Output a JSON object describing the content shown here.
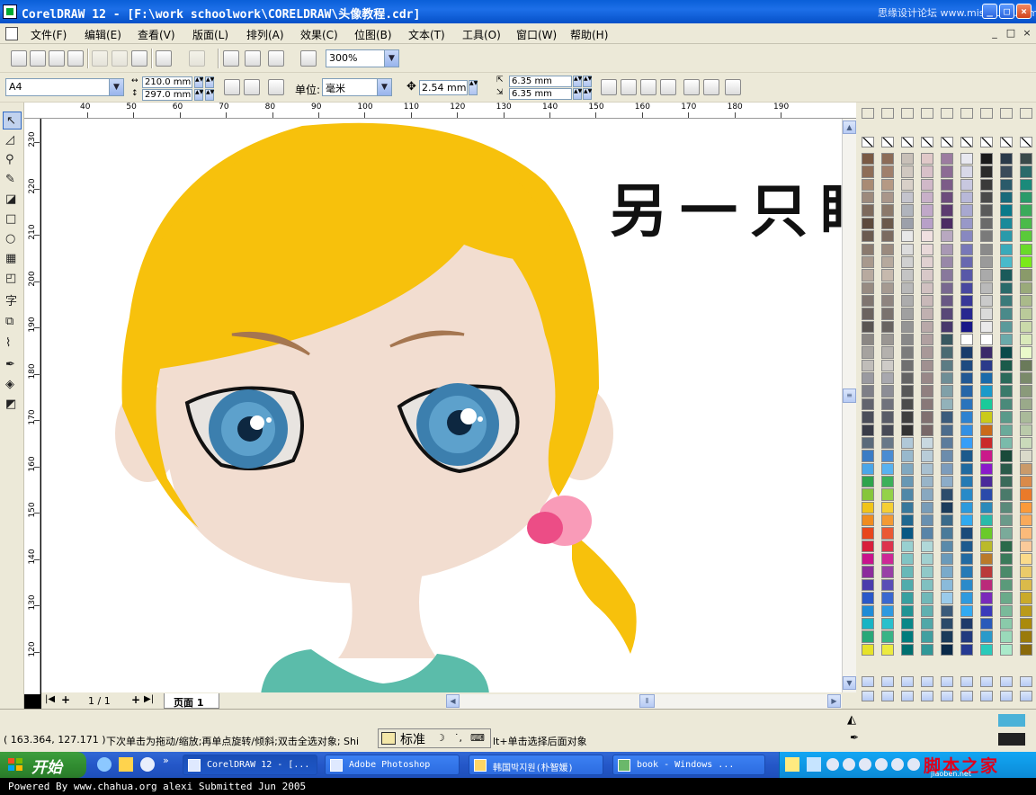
{
  "window": {
    "title": "CorelDRAW 12 - [F:\\work schoolwork\\CORELDRAW\\头像教程.cdr]",
    "watermark": "思缘设计论坛 www.missyuan.com",
    "minimize": "_",
    "maximize": "□",
    "close": "×"
  },
  "menus": [
    "文件(F)",
    "编辑(E)",
    "查看(V)",
    "版面(L)",
    "排列(A)",
    "效果(C)",
    "位图(B)",
    "文本(T)",
    "工具(O)",
    "窗口(W)",
    "帮助(H)"
  ],
  "mdi_buttons": [
    "_",
    "□",
    "×"
  ],
  "toolbar1": {
    "zoom": "300%"
  },
  "toolbar2": {
    "paper": "A4",
    "width": "210.0 mm",
    "height": "297.0 mm",
    "unit_label": "单位:",
    "unit": "毫米",
    "nudge": "2.54 mm",
    "dup_x": "6.35 mm",
    "dup_y": "6.35 mm"
  },
  "rulers": {
    "h_labels": [
      "40",
      "50",
      "60",
      "70",
      "80",
      "90",
      "100",
      "110",
      "120",
      "130",
      "140",
      "150",
      "160",
      "170",
      "180",
      "190"
    ],
    "v_labels": [
      "230",
      "220",
      "210",
      "200",
      "190",
      "180",
      "170",
      "160",
      "150",
      "140",
      "130",
      "120"
    ]
  },
  "canvas": {
    "calligraphy": "另一只眼睛"
  },
  "page_nav": {
    "counter": "1 / 1",
    "tab": "页面 1"
  },
  "status": {
    "coords": "( 163.364, 127.171 )",
    "hint": "下次单击为拖动/缩放;再单点旋转/倾斜;双击全选对象; Shi",
    "hint_tail": "lt+单击选择后面对象",
    "ime_label": "标准",
    "fill_color": "#4bb2d8",
    "outline_color": "#222222"
  },
  "taskbar": {
    "start": "开始",
    "tasks": [
      "CorelDRAW 12 - [...",
      "Adobe Photoshop",
      "韩国박지원(朴智媛)",
      "book - Windows ..."
    ],
    "tray_brand": "脚本之家",
    "tray_url": "jiaoben.net"
  },
  "credit": "Powered By www.chahua.org alexi Submitted Jun 2005",
  "colors": {
    "hair": "#f7c10c",
    "skin": "#f2ddd0",
    "shirt": "#5bbcaa",
    "iris": "#3c7fae",
    "bow_dark": "#ec4d86",
    "bow_light": "#f99bb8"
  }
}
